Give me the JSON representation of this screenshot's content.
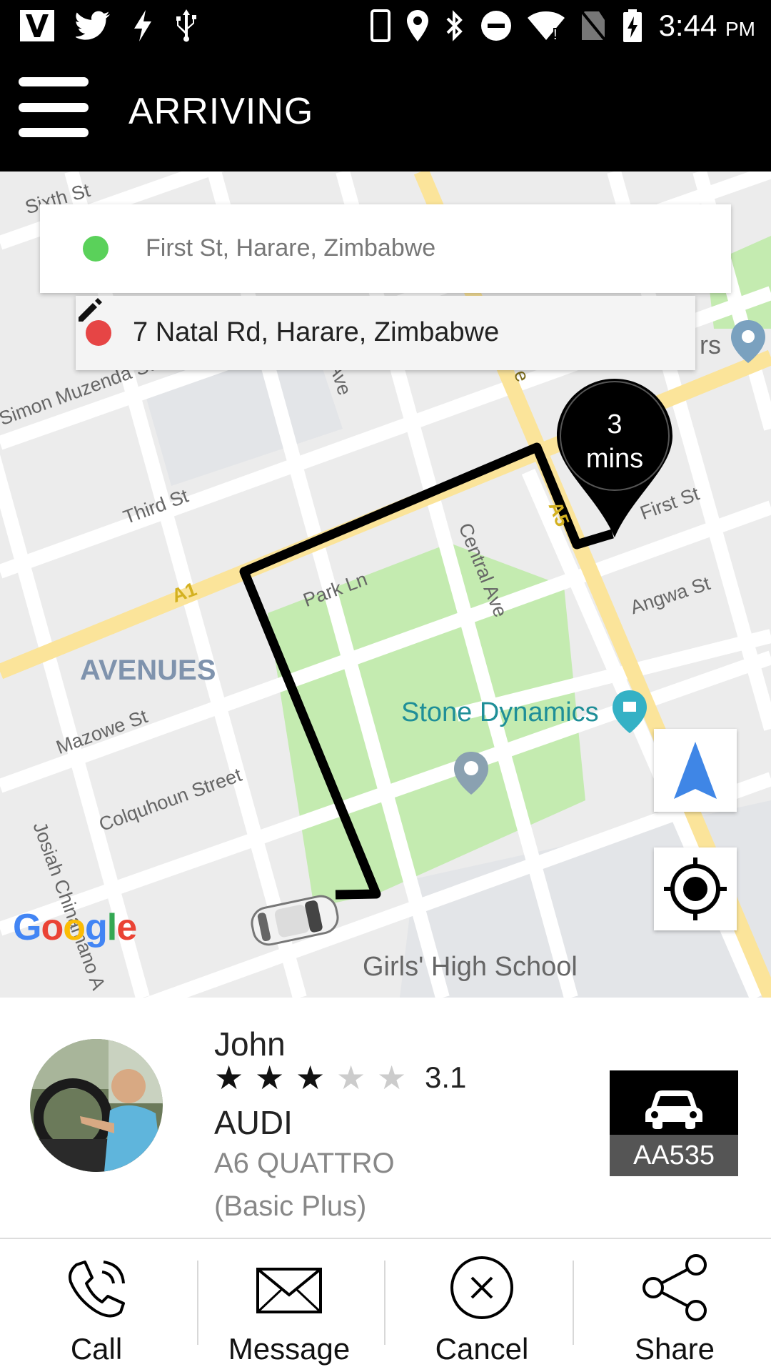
{
  "status_bar": {
    "time": "3:44",
    "ampm": "PM",
    "icons": [
      "v-app-icon",
      "twitter-icon",
      "bolt-icon",
      "usb-icon",
      "phone-icon",
      "location-icon",
      "bluetooth-icon",
      "do-not-disturb-icon",
      "wifi-icon",
      "no-sim-icon",
      "battery-charging-icon"
    ]
  },
  "app_bar": {
    "title": "ARRIVING",
    "menu_icon": "hamburger-menu-icon"
  },
  "trip": {
    "pickup": "First St, Harare, Zimbabwe",
    "dropoff": "7 Natal Rd, Harare, Zimbabwe",
    "eta_value": "3",
    "eta_unit": "mins"
  },
  "map": {
    "labels": {
      "sixth_st": "Sixth St",
      "simon_muzenda": "Simon Muzenda St",
      "third_st": "Third St",
      "park_ln": "Park Ln",
      "central_ave": "Central Ave",
      "mitchel_ave": "hel Ave",
      "first_st": "First St",
      "angwa_st": "Angwa St",
      "avenues": "AVENUES",
      "stone_dynamics": "Stone Dynamics",
      "mazowe_st": "Mazowe St",
      "colquhoun": "Colquhoun Street",
      "josiah": "Josiah Chinamano A",
      "girls_high": "Girls' High School",
      "a1": "A1",
      "a5": "A5",
      "ious_ave": "ious Ave",
      "rs": "rs"
    },
    "google_letters": [
      "G",
      "o",
      "o",
      "g",
      "l",
      "e"
    ]
  },
  "driver": {
    "name": "John",
    "rating": 3.1,
    "rating_text": "3.1",
    "stars_filled": 3,
    "stars_total": 5,
    "car_make": "AUDI",
    "car_model": "A6 QUATTRO",
    "car_class": "(Basic Plus)",
    "plate": "AA535"
  },
  "actions": [
    {
      "label": "Call",
      "icon": "phone-call-icon"
    },
    {
      "label": "Message",
      "icon": "envelope-icon"
    },
    {
      "label": "Cancel",
      "icon": "cancel-circle-icon"
    },
    {
      "label": "Share",
      "icon": "share-icon"
    }
  ],
  "colors": {
    "pickup_dot": "#5ad15a",
    "dropoff_dot": "#e64545",
    "navigate_arrow": "#3f86e6",
    "park": "#c4ebb0",
    "arterial": "#fbe49a"
  }
}
